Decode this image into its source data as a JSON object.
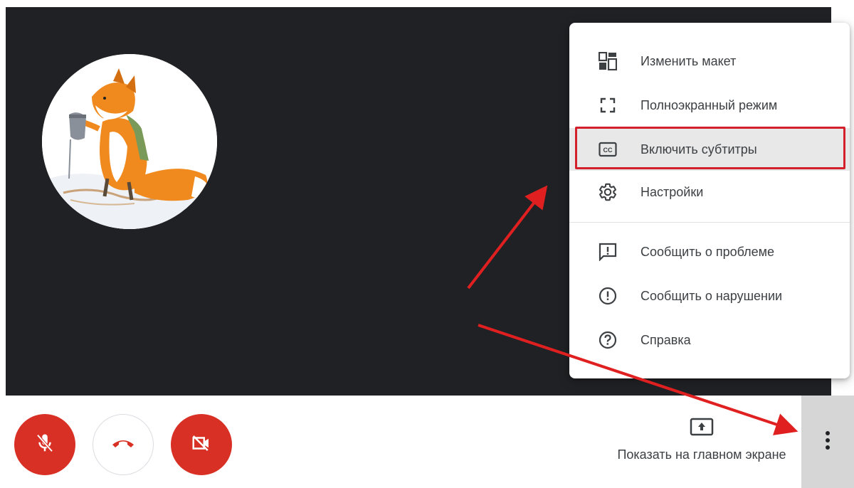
{
  "call": {
    "avatar_label": "participant-avatar",
    "controls": {
      "mic": {
        "state": "muted",
        "icon": "mic-off-icon"
      },
      "hangup": {
        "icon": "phone-hangup-icon"
      },
      "camera": {
        "state": "off",
        "icon": "camera-off-icon"
      }
    },
    "present": {
      "label": "Показать на главном экране",
      "icon": "present-screen-icon"
    },
    "more": {
      "icon": "more-vert-icon"
    }
  },
  "menu": {
    "items": [
      {
        "label": "Изменить макет",
        "icon": "layout-icon"
      },
      {
        "label": "Полноэкранный режим",
        "icon": "fullscreen-icon"
      },
      {
        "label": "Включить субтитры",
        "icon": "closed-captions-icon",
        "highlighted": true
      },
      {
        "label": "Настройки",
        "icon": "gear-icon"
      },
      {
        "label": "Сообщить о проблеме",
        "icon": "feedback-icon"
      },
      {
        "label": "Сообщить о нарушении",
        "icon": "report-icon"
      },
      {
        "label": "Справка",
        "icon": "help-icon"
      }
    ]
  },
  "colors": {
    "video_bg": "#202124",
    "danger": "#d93025",
    "annotation": "#e02020",
    "text": "#3c4043"
  }
}
